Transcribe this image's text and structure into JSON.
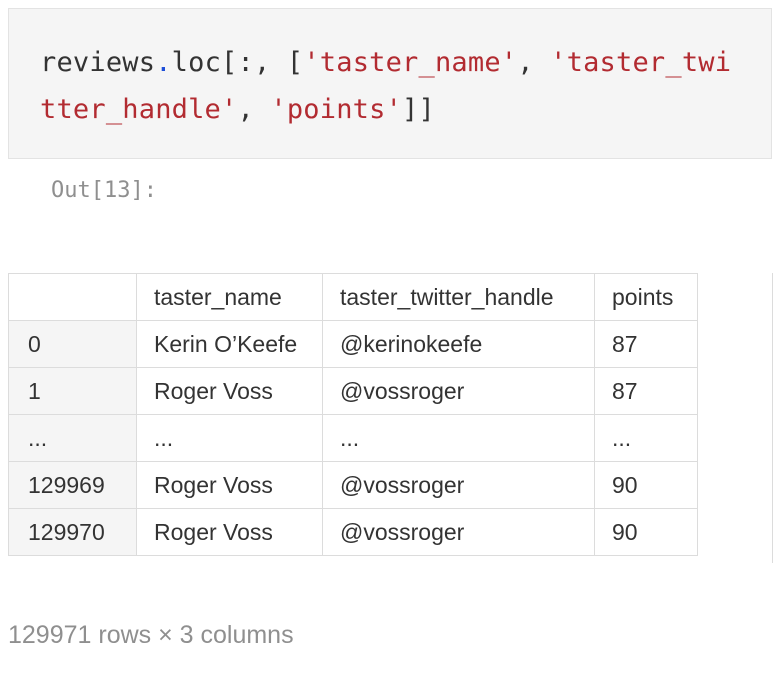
{
  "code_cell": {
    "line1": {
      "var": "reviews",
      "dot": ".",
      "method": "loc[:, [",
      "str1": "'taster_name'",
      "sep1": ", ",
      "str2_part1": "'taster_twi"
    },
    "line2": {
      "str2_part2": "tter_handle'",
      "sep2": ", ",
      "str3": "'points'",
      "close": "]]"
    }
  },
  "output": {
    "prompt": "Out[13]:"
  },
  "table": {
    "columns": [
      "",
      "taster_name",
      "taster_twitter_handle",
      "points"
    ],
    "rows": [
      {
        "index": "0",
        "taster_name": "Kerin O’Keefe",
        "taster_twitter_handle": "@kerinokeefe",
        "points": "87"
      },
      {
        "index": "1",
        "taster_name": "Roger Voss",
        "taster_twitter_handle": "@vossroger",
        "points": "87"
      },
      {
        "index": "...",
        "taster_name": "...",
        "taster_twitter_handle": "...",
        "points": "..."
      },
      {
        "index": "129969",
        "taster_name": "Roger Voss",
        "taster_twitter_handle": "@vossroger",
        "points": "90"
      },
      {
        "index": "129970",
        "taster_name": "Roger Voss",
        "taster_twitter_handle": "@vossroger",
        "points": "90"
      }
    ]
  },
  "footer": {
    "shape": "129971 rows × 3 columns"
  },
  "colors": {
    "string": "#b22b31",
    "operator": "#1d4ed8",
    "code_bg": "#f5f5f5",
    "muted": "#8f8f8f"
  }
}
